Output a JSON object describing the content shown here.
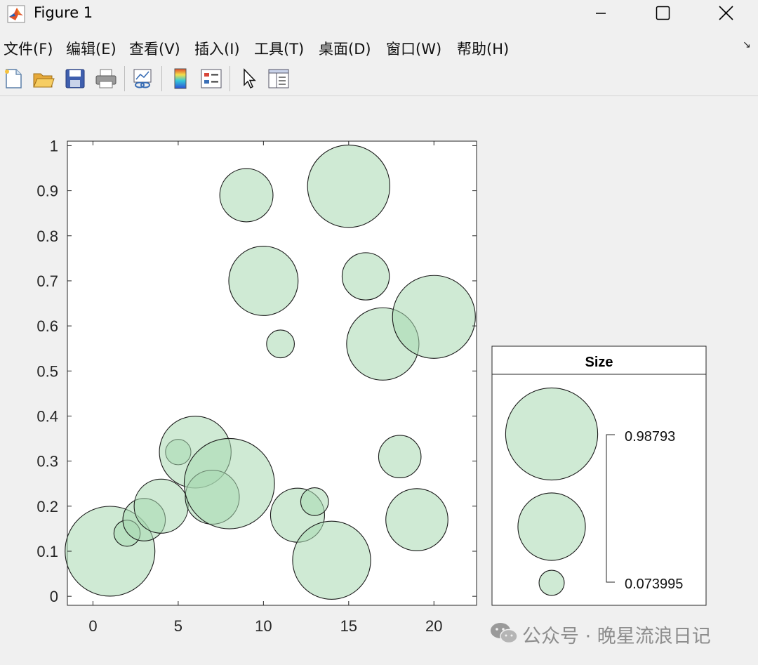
{
  "window": {
    "title": "Figure 1",
    "icon": "matlab-icon",
    "controls": [
      "minimize-icon",
      "maximize-icon",
      "close-icon"
    ]
  },
  "menu": [
    {
      "label": "文件(F)",
      "key": "F"
    },
    {
      "label": "编辑(E)",
      "key": "E"
    },
    {
      "label": "查看(V)",
      "key": "V"
    },
    {
      "label": "插入(I)",
      "key": "I"
    },
    {
      "label": "工具(T)",
      "key": "T"
    },
    {
      "label": "桌面(D)",
      "key": "D"
    },
    {
      "label": "窗口(W)",
      "key": "W"
    },
    {
      "label": "帮助(H)",
      "key": "H"
    }
  ],
  "toolbar": [
    "new-figure-icon",
    "open-file-icon",
    "save-icon",
    "print-icon",
    "link-plot-icon",
    "colorbar-icon",
    "legend-icon",
    "select-pointer-icon",
    "property-inspector-icon"
  ],
  "chart_data": {
    "type": "scatter",
    "title": "",
    "xlabel": "",
    "ylabel": "",
    "xlim": [
      -1.5,
      22.5
    ],
    "ylim": [
      -0.02,
      1.01
    ],
    "xticks": [
      0,
      5,
      10,
      15,
      20
    ],
    "yticks": [
      0,
      0.1,
      0.2,
      0.3,
      0.4,
      0.5,
      0.6,
      0.7,
      0.8,
      0.9,
      1
    ],
    "yticklabels": [
      "0",
      "0.1",
      "0.2",
      "0.3",
      "0.4",
      "0.5",
      "0.6",
      "0.7",
      "0.8",
      "0.9",
      "1"
    ],
    "marker_color": "#a8d8b0",
    "marker_alpha": 0.55,
    "edge_color": "#1a1a1a",
    "points": [
      {
        "x": 1,
        "y": 0.1,
        "size": 0.94
      },
      {
        "x": 2,
        "y": 0.14,
        "size": 0.08
      },
      {
        "x": 3,
        "y": 0.17,
        "size": 0.21
      },
      {
        "x": 4,
        "y": 0.2,
        "size": 0.34
      },
      {
        "x": 5,
        "y": 0.32,
        "size": 0.075
      },
      {
        "x": 6,
        "y": 0.32,
        "size": 0.6
      },
      {
        "x": 7,
        "y": 0.22,
        "size": 0.34
      },
      {
        "x": 8,
        "y": 0.25,
        "size": 0.95
      },
      {
        "x": 9,
        "y": 0.89,
        "size": 0.33
      },
      {
        "x": 10,
        "y": 0.7,
        "size": 0.56
      },
      {
        "x": 11,
        "y": 0.56,
        "size": 0.09
      },
      {
        "x": 12,
        "y": 0.18,
        "size": 0.34
      },
      {
        "x": 13,
        "y": 0.21,
        "size": 0.09
      },
      {
        "x": 14,
        "y": 0.08,
        "size": 0.71
      },
      {
        "x": 15,
        "y": 0.91,
        "size": 0.79
      },
      {
        "x": 16,
        "y": 0.71,
        "size": 0.26
      },
      {
        "x": 17,
        "y": 0.56,
        "size": 0.61
      },
      {
        "x": 18,
        "y": 0.31,
        "size": 0.21
      },
      {
        "x": 19,
        "y": 0.17,
        "size": 0.45
      },
      {
        "x": 20,
        "y": 0.62,
        "size": 0.8
      }
    ],
    "size_legend": {
      "title": "Size",
      "max_label": "0.98793",
      "min_label": "0.073995",
      "sizes": [
        0.98793,
        0.53,
        0.073995
      ]
    }
  },
  "watermark": "公众号 · 晚星流浪日记"
}
